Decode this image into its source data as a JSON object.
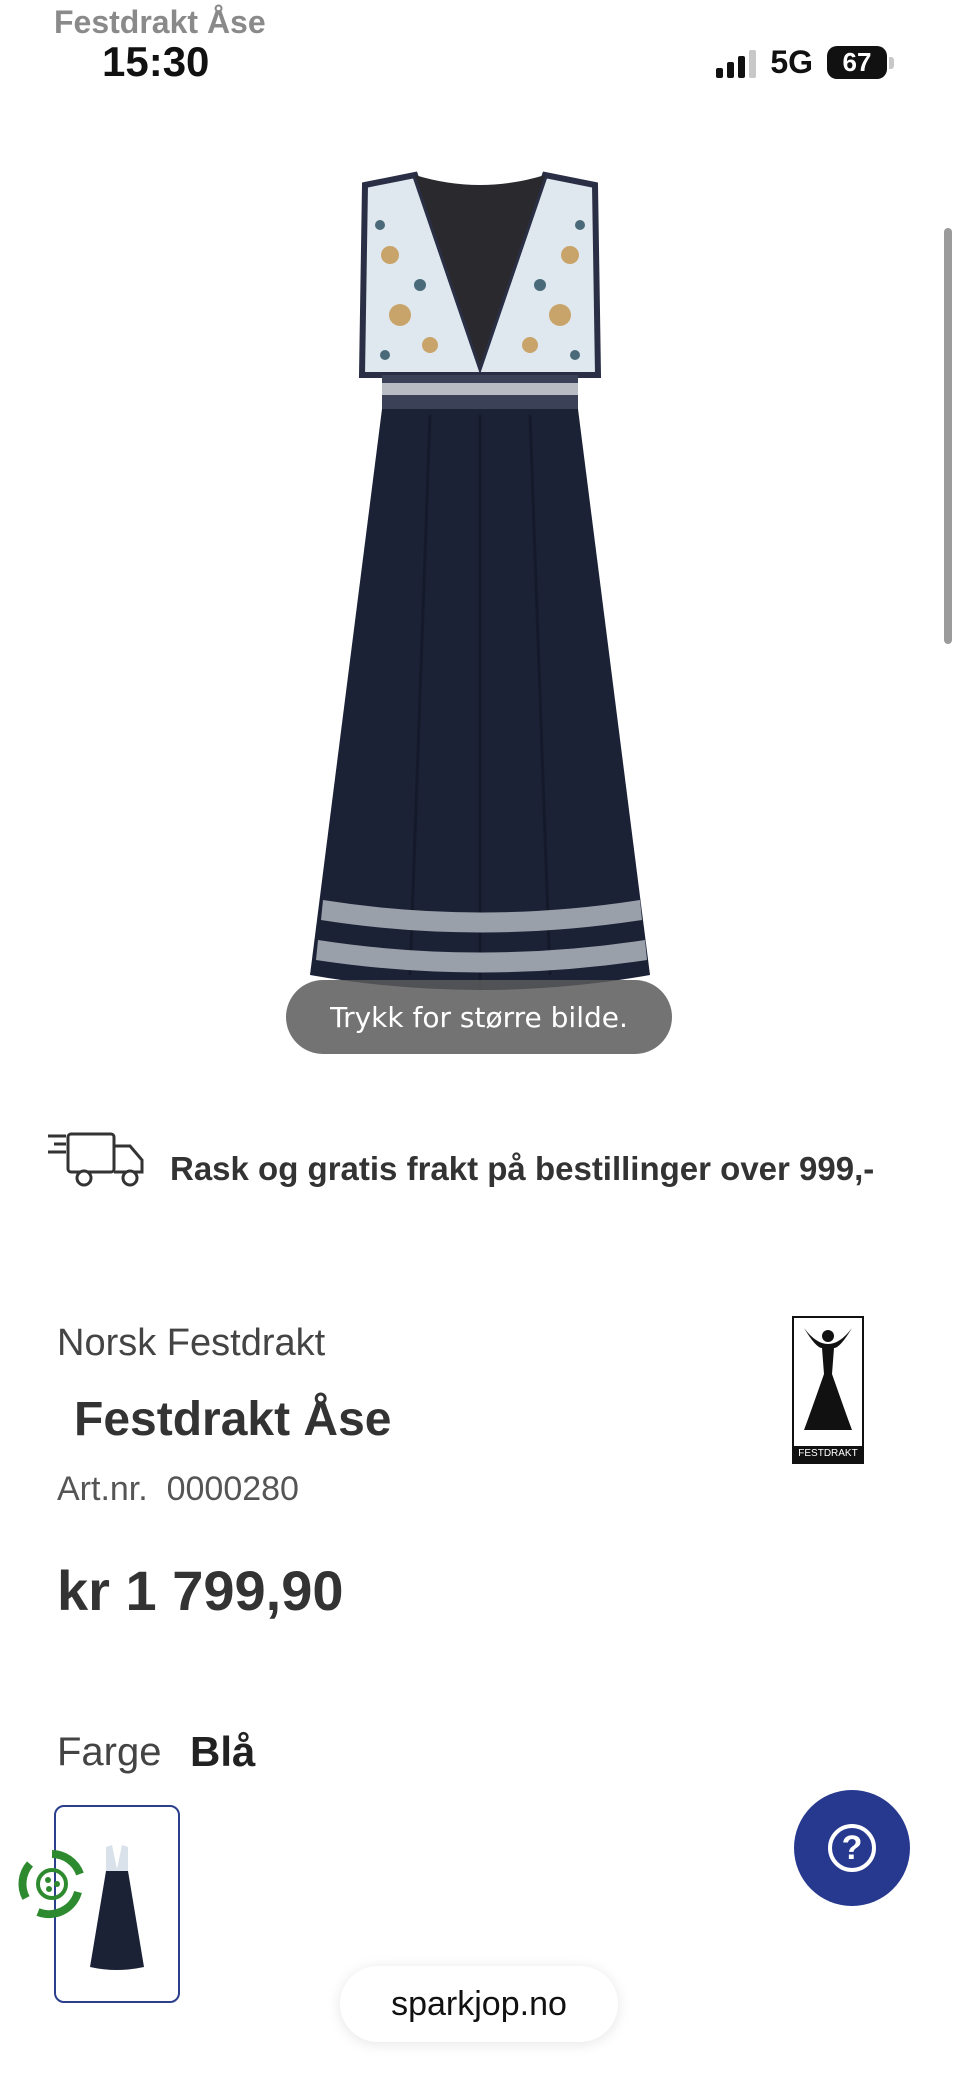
{
  "status_bar": {
    "app_title": "Festdrakt Åse",
    "time": "15:30",
    "network": "5G",
    "battery": "67"
  },
  "product_image": {
    "tooltip": "Trykk for større bilde."
  },
  "shipping": {
    "text": "Rask og gratis frakt på bestillinger over 999,-"
  },
  "product": {
    "brand": "Norsk Festdrakt",
    "title": "Festdrakt Åse",
    "art_nr_label": "Art.nr.",
    "art_nr_value": "0000280",
    "art_nr": "Art.nr.  0000280",
    "price": "kr 1 799,90",
    "brand_logo_text": "FESTDRAKT"
  },
  "color": {
    "label": "Farge",
    "value": "Blå"
  },
  "url_bar": {
    "domain": "sparkjop.no"
  },
  "colors": {
    "dress_navy": "#1c2236",
    "accent_blue": "#27398f",
    "text_dark": "#333333"
  }
}
